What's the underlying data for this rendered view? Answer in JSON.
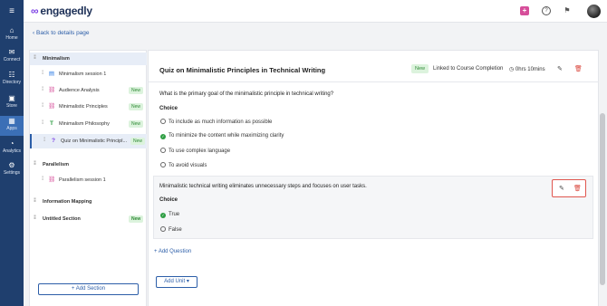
{
  "nav": [
    {
      "label": "Home",
      "icon": "home-icon",
      "glyph": "⌂"
    },
    {
      "label": "Connect",
      "icon": "connect-icon",
      "glyph": "✉"
    },
    {
      "label": "Directory",
      "icon": "directory-icon",
      "glyph": "☷"
    },
    {
      "label": "Store",
      "icon": "store-icon",
      "glyph": "▣"
    },
    {
      "label": "Apps",
      "icon": "apps-icon",
      "glyph": "▦"
    },
    {
      "label": "Analytics",
      "icon": "analytics-icon",
      "glyph": "◔"
    },
    {
      "label": "Settings",
      "icon": "settings-icon",
      "glyph": "⚙"
    }
  ],
  "menu_glyph": "≡",
  "brand": {
    "name": "engagedly",
    "mark": "∞"
  },
  "topbar": {
    "plus": "+",
    "help": "?",
    "flag": "⚑"
  },
  "back_link": "Back to details page",
  "sidebar": {
    "sections": [
      {
        "title": "Minimalism",
        "items": [
          {
            "label": "Minimalism session 1",
            "icon": "document-icon",
            "glyph": "▤",
            "color": "#2c7be5",
            "badge": ""
          },
          {
            "label": "Audience Analysis",
            "icon": "link-icon",
            "glyph": "⛓",
            "color": "#d64e9a",
            "badge": "New"
          },
          {
            "label": "Minimalistic Principles",
            "icon": "link-icon",
            "glyph": "⛓",
            "color": "#d64e9a",
            "badge": "New"
          },
          {
            "label": "Minimalism Philosophy",
            "icon": "text-icon",
            "glyph": "T",
            "color": "#2f9e44",
            "badge": "New"
          },
          {
            "label": "Quiz on Minimalistic Principl...",
            "icon": "quiz-icon",
            "glyph": "?",
            "color": "#7b3fe4",
            "badge": "New"
          }
        ]
      },
      {
        "title": "Parallelism",
        "items": [
          {
            "label": "Parallelism session 1",
            "icon": "link-icon",
            "glyph": "⛓",
            "color": "#d64e9a",
            "badge": ""
          }
        ]
      },
      {
        "title": "Information Mapping",
        "items": []
      },
      {
        "title": "Untitled Section",
        "badge": "New",
        "items": []
      }
    ],
    "add_section": "+ Add Section"
  },
  "quiz": {
    "title": "Quiz on Minimalistic Principles in Technical Writing",
    "badge": "New",
    "linked": "Linked to Course Completion",
    "duration": "0hrs 10mins",
    "questions": [
      {
        "text": "What is the primary goal of the minimalistic principle in technical writing?",
        "choice_label": "Choice",
        "options": [
          "To include as much information as possible",
          "To minimize the content while maximizing clarity",
          "To use complex language",
          "To avoid visuals"
        ]
      },
      {
        "text": "Minimalistic technical writing eliminates unnecessary steps and focuses on user tasks.",
        "choice_label": "Choice",
        "options": [
          "True",
          "False"
        ]
      }
    ],
    "add_question": "+ Add Question",
    "add_unit": "Add Unit ▾"
  }
}
